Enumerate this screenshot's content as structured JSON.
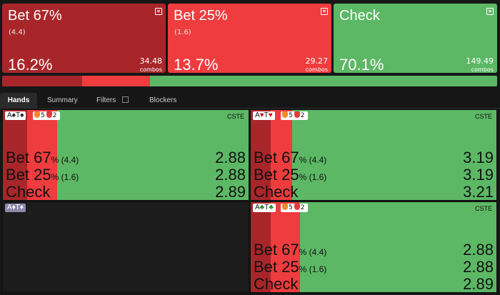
{
  "colors": {
    "bet67": "#a8262a",
    "bet25": "#ef3c3e",
    "check": "#5cb865",
    "bg": "#161616"
  },
  "actions": [
    {
      "title": "Bet 67%",
      "sub": "(4.4)",
      "pct": "16.2%",
      "combos": "34.48",
      "combos_label": "combos"
    },
    {
      "title": "Bet 25%",
      "sub": "(1.6)",
      "pct": "13.7%",
      "combos": "29.27",
      "combos_label": "combos"
    },
    {
      "title": "Check",
      "sub": "",
      "pct": "70.1%",
      "combos": "149.49",
      "combos_label": "combos"
    }
  ],
  "frequency_bar": {
    "bet67": 0.162,
    "bet25": 0.137,
    "check": 0.701
  },
  "tabs": [
    "Hands",
    "Summary",
    "Filters",
    "Blockers"
  ],
  "hands": [
    {
      "cards": [
        {
          "r": "A",
          "s": "♠"
        },
        {
          "r": "T",
          "s": "♠"
        }
      ],
      "blockers": [
        "5",
        "2"
      ],
      "cste": "CSTE",
      "freq": {
        "bet67": 0.1,
        "bet25": 0.12,
        "check": 0.78
      },
      "rows": [
        {
          "action": "Bet 67",
          "pct": "%",
          "size": "(4.4)",
          "value": "2.88"
        },
        {
          "action": "Bet 25",
          "pct": "%",
          "size": "(1.6)",
          "value": "2.88"
        },
        {
          "action": "Check",
          "pct": "",
          "size": "",
          "value": "2.89"
        }
      ]
    },
    {
      "cards": [
        {
          "r": "A",
          "s": "♥"
        },
        {
          "r": "T",
          "s": "♥"
        }
      ],
      "blockers": [
        "5",
        "2"
      ],
      "cste": "CSTE",
      "freq": {
        "bet67": 0.08,
        "bet25": 0.09,
        "check": 0.83
      },
      "rows": [
        {
          "action": "Bet 67",
          "pct": "%",
          "size": "(4.4)",
          "value": "3.19"
        },
        {
          "action": "Bet 25",
          "pct": "%",
          "size": "(1.6)",
          "value": "3.19"
        },
        {
          "action": "Check",
          "pct": "",
          "size": "",
          "value": "3.21"
        }
      ]
    },
    {
      "cards": [
        {
          "r": "A",
          "s": "♦"
        },
        {
          "r": "T",
          "s": "♦"
        }
      ],
      "dimmed": true
    },
    {
      "cards": [
        {
          "r": "A",
          "s": "♣"
        },
        {
          "r": "T",
          "s": "♣"
        }
      ],
      "blockers": [
        "5",
        "2"
      ],
      "cste": "CSTE",
      "freq": {
        "bet67": 0.08,
        "bet25": 0.12,
        "check": 0.8
      },
      "rows": [
        {
          "action": "Bet 67",
          "pct": "%",
          "size": "(4.4)",
          "value": "2.88"
        },
        {
          "action": "Bet 25",
          "pct": "%",
          "size": "(1.6)",
          "value": "2.88"
        },
        {
          "action": "Check",
          "pct": "",
          "size": "",
          "value": "2.89"
        }
      ]
    }
  ]
}
